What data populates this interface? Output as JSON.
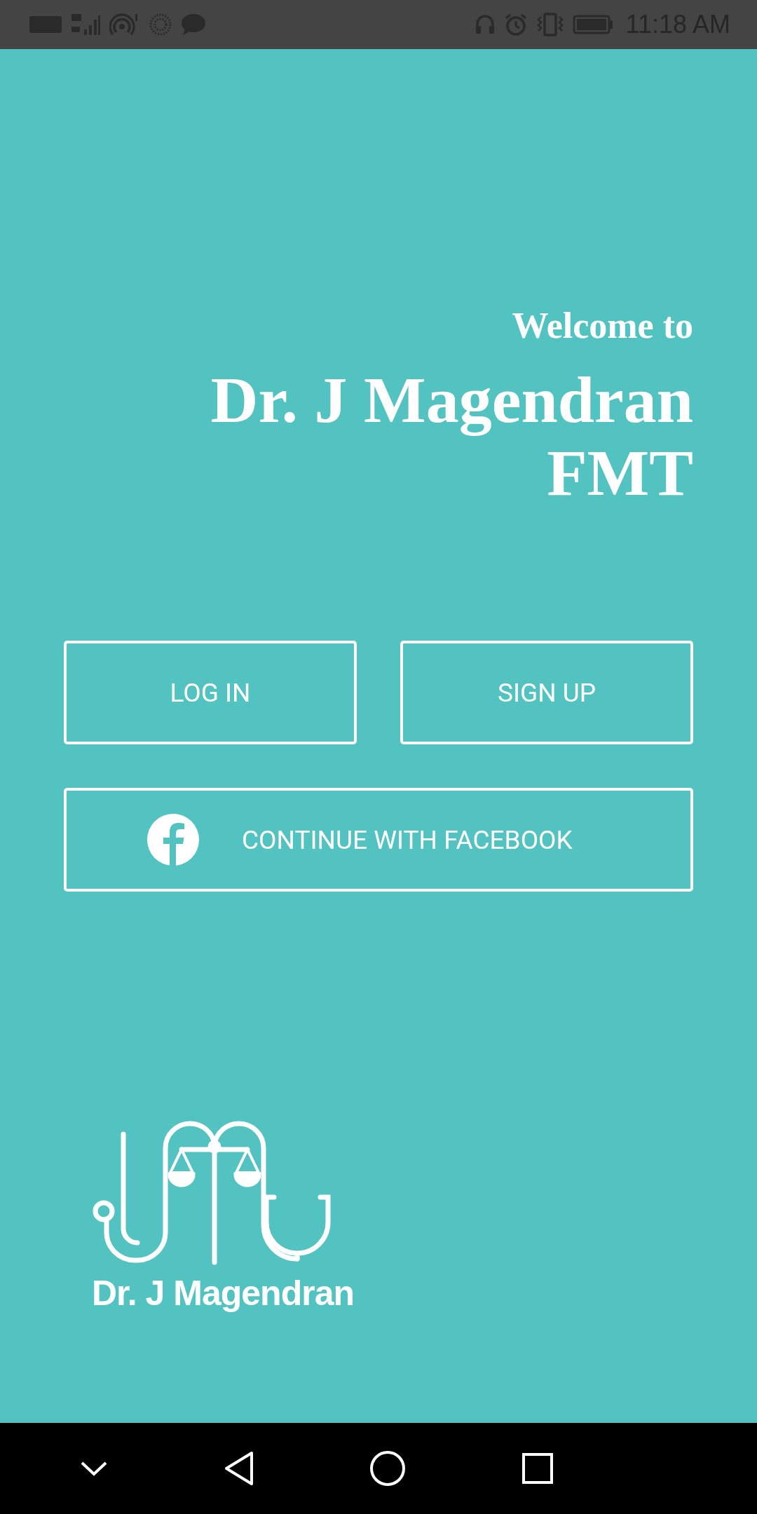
{
  "status_bar": {
    "time": "11:18 AM"
  },
  "welcome": "Welcome to",
  "title_lines": [
    "Dr. J Magendran",
    "FMT"
  ],
  "buttons": [
    {
      "label": "LOG IN",
      "kind": "plain"
    },
    {
      "label": "SIGN UP",
      "kind": "plain"
    },
    {
      "label": "CONTINUE WITH FACEBOOK",
      "kind": "facebook"
    }
  ],
  "logo": {
    "text": "Dr. J Magendran"
  }
}
